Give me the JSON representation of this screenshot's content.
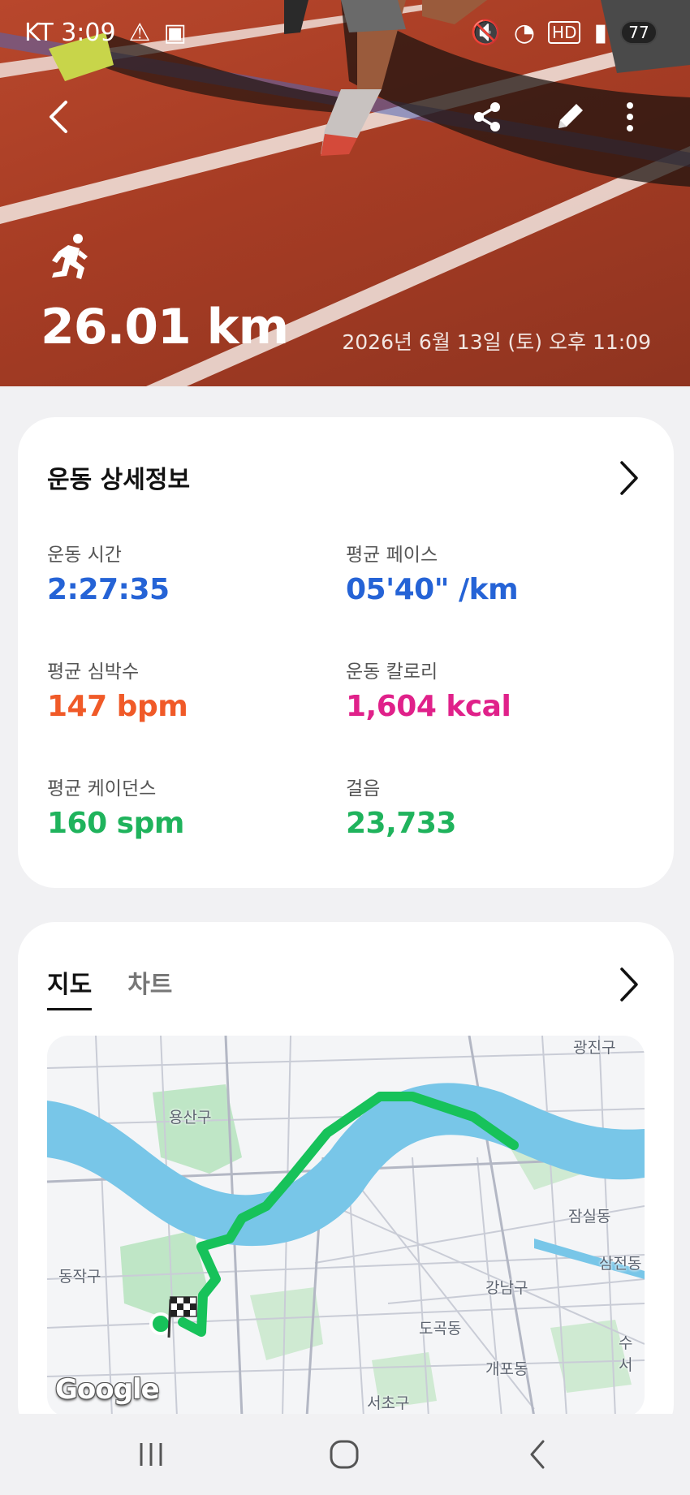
{
  "status_bar": {
    "time": "KT 3:09",
    "battery": "77"
  },
  "hero": {
    "distance": "26.01 km",
    "datetime": "2026년 6월 13일 (토) 오후 11:09",
    "activity_icon": "running-person-icon"
  },
  "toolbar": {
    "back_icon": "back-icon",
    "share_icon": "share-icon",
    "edit_icon": "edit-icon",
    "more_icon": "more-vertical-icon"
  },
  "details": {
    "title": "운동 상세정보",
    "stats": [
      {
        "label": "운동 시간",
        "value": "2:27:35",
        "color": "#2563d6"
      },
      {
        "label": "평균 페이스",
        "value": "05'40\" /km",
        "color": "#2563d6"
      },
      {
        "label": "평균 심박수",
        "value": "147 bpm",
        "color": "#f05a28"
      },
      {
        "label": "운동 칼로리",
        "value": "1,604 kcal",
        "color": "#e0218a"
      },
      {
        "label": "평균 케이던스",
        "value": "160 spm",
        "color": "#1fb35c"
      },
      {
        "label": "걸음",
        "value": "23,733",
        "color": "#1fb35c"
      }
    ]
  },
  "map_card": {
    "tabs": [
      "지도",
      "차트"
    ],
    "active_tab": "지도",
    "labels": {
      "gwangjin": "광진구",
      "yongsan": "용산구",
      "jamsil": "잠실동",
      "samseong": "삼전동",
      "dongjak": "동작구",
      "gangnam": "강남구",
      "dogok": "도곡동",
      "suseo": "수서",
      "gaepo": "개포동",
      "seocho": "서초구"
    },
    "google": "Google",
    "route_color": "#17c25a",
    "river_color": "#6ec3e6"
  },
  "nav": {
    "recents_icon": "recents-icon",
    "home_icon": "home-icon",
    "back_icon": "nav-back-icon"
  }
}
